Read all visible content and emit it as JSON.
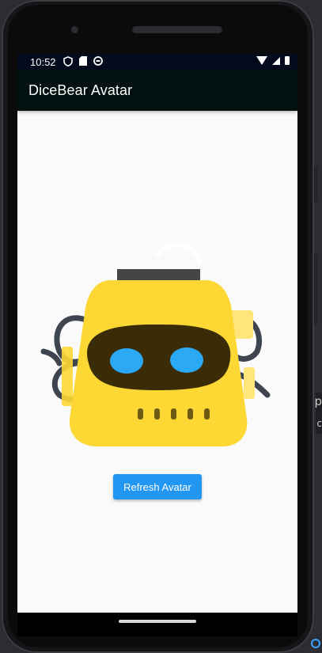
{
  "status_bar": {
    "time": "10:52",
    "left_icons": [
      "shield-icon",
      "sd-card-icon",
      "sync-icon"
    ],
    "right_icons": [
      "wifi-icon",
      "signal-icon",
      "battery-icon"
    ]
  },
  "app_bar": {
    "title": "DiceBear Avatar"
  },
  "main": {
    "avatar": {
      "style": "bottts",
      "colors": {
        "body": "#FDD835",
        "face": "#3A2C06",
        "eyes": "#2CA9F5",
        "cables": "#3E4450",
        "top": "#454545"
      }
    },
    "refresh_button_label": "Refresh Avatar"
  },
  "background_window": {
    "text_top": "p",
    "text_bottom": "c"
  },
  "colors": {
    "app_bar": "#031111",
    "accent": "#2196F3",
    "screen_bg": "#FAFAFA"
  }
}
